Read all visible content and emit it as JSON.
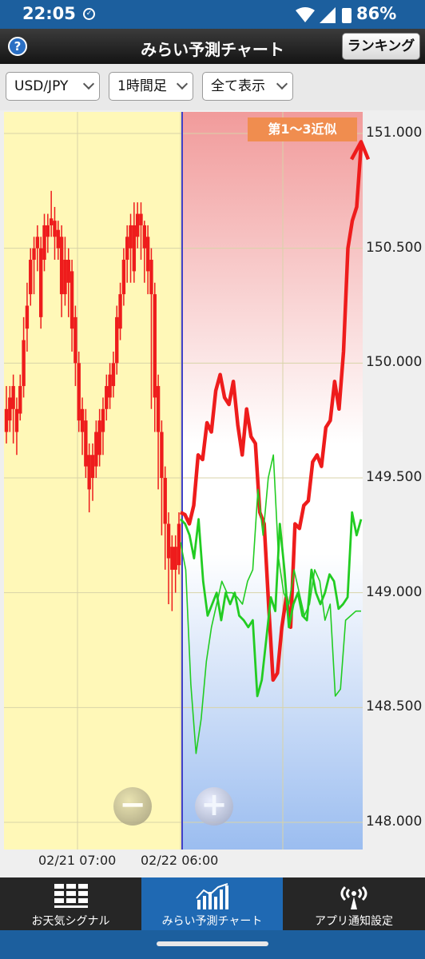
{
  "status_bar": {
    "time": "22:05",
    "battery": "86%"
  },
  "header": {
    "title": "みらい予測チャート",
    "help_label": "?",
    "ranking_button": "ランキング"
  },
  "selectors": {
    "pair": "USD/JPY",
    "timeframe": "1時間足",
    "display": "全て表示"
  },
  "chart": {
    "badge": "第1～3近似"
  },
  "chart_data": {
    "type": "line",
    "title": "",
    "ylim": [
      147.95,
      151.15
    ],
    "y_ticks": [
      "151.000",
      "150.500",
      "150.000",
      "149.500",
      "149.000",
      "148.500",
      "148.000"
    ],
    "x_tick_labels": [
      "02/21 07:00",
      "02/22 06:00"
    ],
    "series": [
      {
        "type": "candlestick",
        "values": [
          [
            149.7,
            149.8,
            149.65,
            149.9
          ],
          [
            149.75,
            149.85,
            149.7,
            149.9
          ],
          [
            149.8,
            149.9,
            149.65,
            149.95
          ],
          [
            149.7,
            149.8,
            149.6,
            149.85
          ],
          [
            149.78,
            149.9,
            149.75,
            149.95
          ],
          [
            149.9,
            150.1,
            149.85,
            150.2
          ],
          [
            150.15,
            150.25,
            150.05,
            150.35
          ],
          [
            150.3,
            150.45,
            150.25,
            150.5
          ],
          [
            150.45,
            150.5,
            150.3,
            150.55
          ],
          [
            150.5,
            150.55,
            150.4,
            150.6
          ],
          [
            150.2,
            150.5,
            150.15,
            150.55
          ],
          [
            150.45,
            150.6,
            150.4,
            150.65
          ],
          [
            150.55,
            150.6,
            150.48,
            150.65
          ],
          [
            150.6,
            150.63,
            150.55,
            150.75
          ],
          [
            150.55,
            150.62,
            150.45,
            150.68
          ],
          [
            150.5,
            150.58,
            150.45,
            150.62
          ],
          [
            150.3,
            150.55,
            150.2,
            150.6
          ],
          [
            150.3,
            150.45,
            150.25,
            150.55
          ],
          [
            150.35,
            150.45,
            150.2,
            150.5
          ],
          [
            150.15,
            150.4,
            150.05,
            150.45
          ],
          [
            150.0,
            150.2,
            149.9,
            150.25
          ],
          [
            149.75,
            150.0,
            149.7,
            150.05
          ],
          [
            149.7,
            149.8,
            149.6,
            149.85
          ],
          [
            149.55,
            149.75,
            149.5,
            149.8
          ],
          [
            149.45,
            149.6,
            149.35,
            149.65
          ],
          [
            149.5,
            149.6,
            149.4,
            149.65
          ],
          [
            149.55,
            149.7,
            149.5,
            149.75
          ],
          [
            149.6,
            149.75,
            149.55,
            149.8
          ],
          [
            149.7,
            149.8,
            149.6,
            149.85
          ],
          [
            149.8,
            149.9,
            149.75,
            149.95
          ],
          [
            149.85,
            149.95,
            149.8,
            150.0
          ],
          [
            149.9,
            150.0,
            149.85,
            150.05
          ],
          [
            150.0,
            150.2,
            149.95,
            150.25
          ],
          [
            150.15,
            150.3,
            150.1,
            150.35
          ],
          [
            150.3,
            150.45,
            150.25,
            150.5
          ],
          [
            150.45,
            150.55,
            150.35,
            150.6
          ],
          [
            150.5,
            150.6,
            150.35,
            150.65
          ],
          [
            150.4,
            150.6,
            150.35,
            150.7
          ],
          [
            150.55,
            150.65,
            150.5,
            150.7
          ],
          [
            150.6,
            150.65,
            150.45,
            150.7
          ],
          [
            150.5,
            150.6,
            150.35,
            150.62
          ],
          [
            150.4,
            150.55,
            150.3,
            150.6
          ],
          [
            150.3,
            150.45,
            149.8,
            150.5
          ],
          [
            149.85,
            150.3,
            149.7,
            150.35
          ],
          [
            149.7,
            149.9,
            149.45,
            149.95
          ],
          [
            149.5,
            149.7,
            149.25,
            149.75
          ],
          [
            149.3,
            149.5,
            149.1,
            149.55
          ],
          [
            149.15,
            149.3,
            148.95,
            149.35
          ],
          [
            149.1,
            149.2,
            148.92,
            149.25
          ],
          [
            149.1,
            149.2,
            149.0,
            149.25
          ],
          [
            149.12,
            149.3,
            149.08,
            149.35
          ]
        ]
      },
      {
        "name": "",
        "color": "#ee1c1c",
        "values": [
          149.35,
          149.34,
          149.3,
          149.38,
          149.6,
          149.58,
          149.74,
          149.7,
          149.88,
          149.95,
          149.85,
          149.82,
          149.92,
          149.73,
          149.6,
          149.8,
          149.68,
          149.65,
          149.35,
          149.3,
          148.95,
          148.62,
          148.65,
          148.85,
          148.98,
          148.85,
          149.3,
          149.28,
          149.38,
          149.4,
          149.57,
          149.6,
          149.55,
          149.72,
          149.75,
          149.92,
          149.8,
          150.05,
          150.5,
          150.62,
          150.68,
          150.95
        ]
      },
      {
        "name": "",
        "color": "#22cc22",
        "values": [
          149.32,
          149.3,
          149.25,
          149.15,
          149.32,
          149.05,
          148.9,
          148.95,
          149.0,
          148.88,
          149.0,
          148.95,
          149.0,
          148.9,
          148.88,
          148.85,
          148.88,
          148.55,
          148.62,
          148.8,
          148.98,
          148.92,
          149.3,
          149.1,
          148.85,
          148.95,
          149.0,
          148.9,
          148.88,
          149.1,
          149.0,
          148.95,
          149.0,
          149.08,
          149.05,
          148.93,
          148.95,
          148.98,
          149.35,
          149.25,
          149.32
        ]
      },
      {
        "name": "",
        "color": "#22cc22",
        "values": [
          149.22,
          149.1,
          148.6,
          148.3,
          148.45,
          148.7,
          148.85,
          148.95,
          149.05,
          149.0,
          149.0,
          148.98,
          148.95,
          149.05,
          149.1,
          149.45,
          149.25,
          149.5,
          149.6,
          149.15,
          149.0,
          148.95,
          149.1,
          149.0,
          148.9,
          148.95,
          149.1,
          149.05,
          148.88,
          148.95,
          148.55,
          148.58,
          148.88,
          148.9,
          148.92,
          148.92
        ]
      }
    ]
  },
  "zoom": {
    "minus": "−",
    "plus": "+"
  },
  "tabs": [
    {
      "label": "お天気シグナル",
      "icon": "grid-icon"
    },
    {
      "label": "みらい予測チャート",
      "icon": "chart-icon"
    },
    {
      "label": "アプリ通知設定",
      "icon": "antenna-icon"
    }
  ]
}
